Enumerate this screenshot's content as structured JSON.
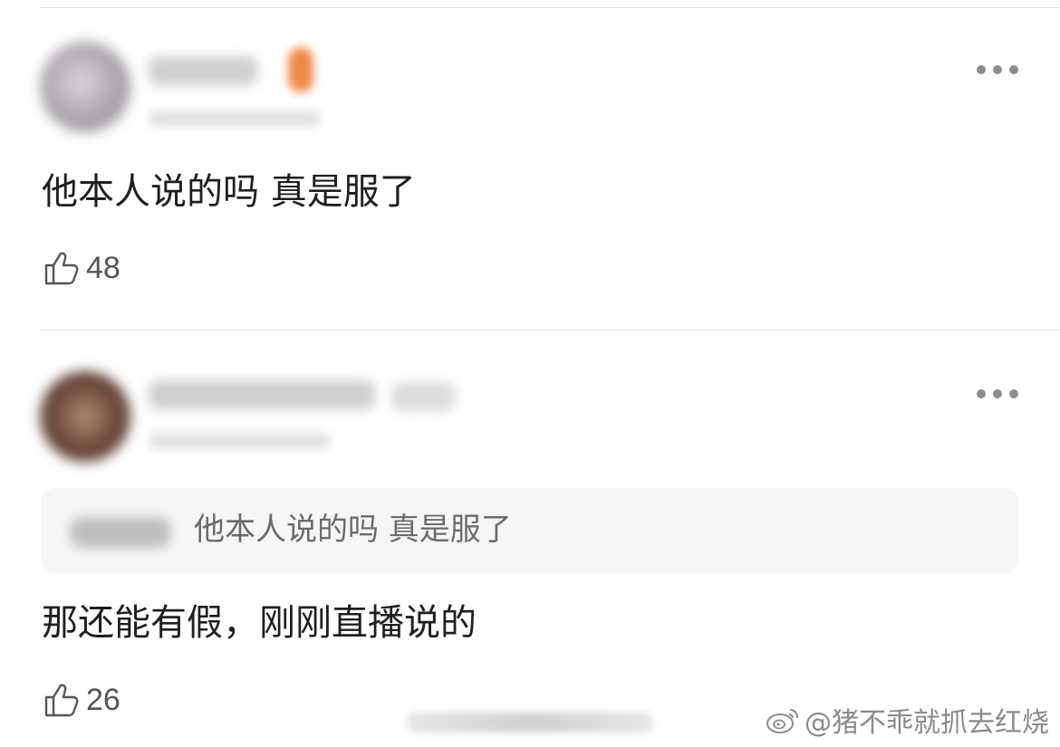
{
  "comments": [
    {
      "text": "他本人说的吗 真是服了",
      "likes": "48",
      "more_icon": "more-horizontal-icon",
      "like_icon": "thumbs-up-icon"
    },
    {
      "quote_text": "他本人说的吗 真是服了",
      "text": "那还能有假，刚刚直播说的",
      "likes": "26",
      "more_icon": "more-horizontal-icon",
      "like_icon": "thumbs-up-icon"
    }
  ],
  "watermark": {
    "text": "@猪不乖就抓去红烧",
    "icon": "weibo-icon"
  },
  "colors": {
    "text": "#1f1f1f",
    "secondary": "#555555",
    "quote_bg": "#f6f6f6",
    "divider": "#e6e6e6"
  }
}
